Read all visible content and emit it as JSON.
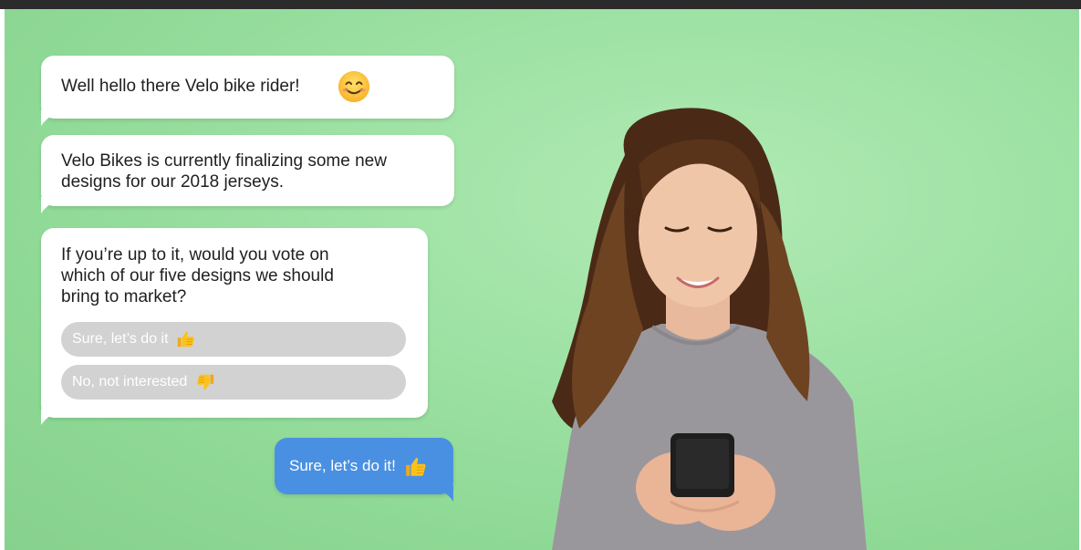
{
  "chat": {
    "greeting": "Well hello there Velo bike rider!",
    "message_line1": "Velo Bikes is currently finalizing some new",
    "message_line2": "designs for our 2018 jerseys.",
    "question_line1": "If you’re up to it, would you vote on",
    "question_line2": "which of our five designs we should",
    "question_line3": "bring to market?",
    "options": [
      {
        "label": "Sure, let’s do it"
      },
      {
        "label": "No, not interested"
      }
    ],
    "user_reply": "Sure, let’s do it!"
  },
  "icons": {
    "greeting_emoji": "smiling-face-icon",
    "option1_emoji": "thumbs-up-icon",
    "option2_emoji": "thumbs-down-icon",
    "reply_emoji": "thumbs-up-icon"
  },
  "colors": {
    "background_green": "#9fe2a5",
    "bubble_white": "#ffffff",
    "option_gray": "#d2d2d2",
    "reply_blue": "#4a90e2",
    "top_bar": "#2b2b2b"
  }
}
